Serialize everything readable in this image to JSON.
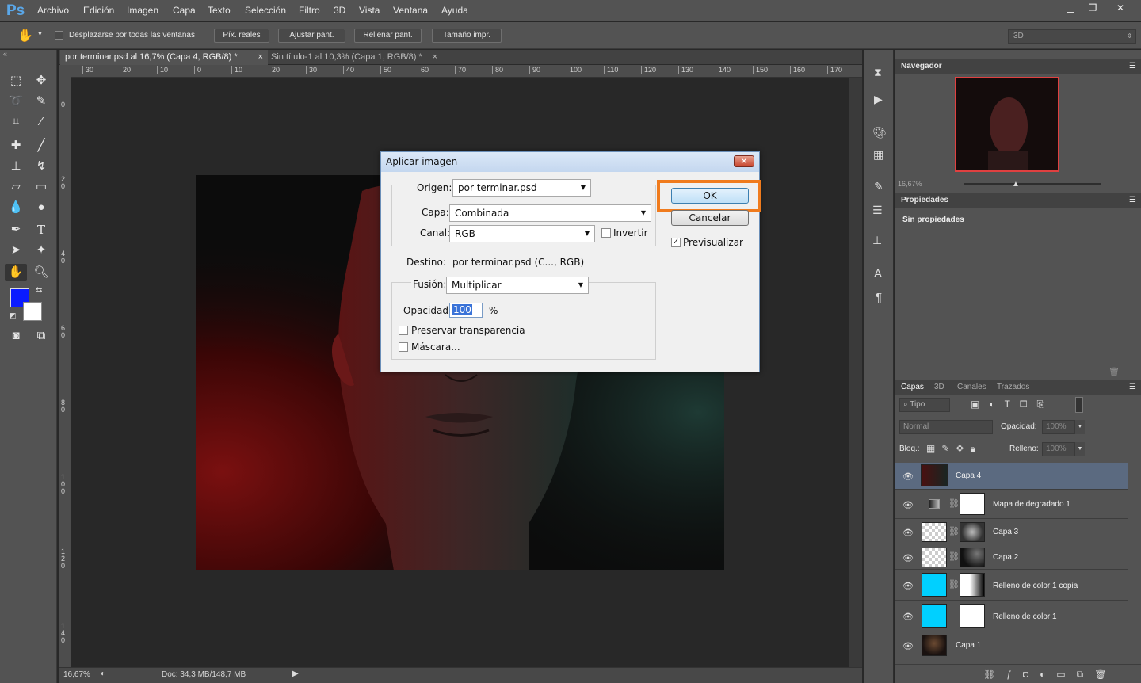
{
  "app": {
    "logo": "Ps"
  },
  "menu": [
    "Archivo",
    "Edición",
    "Imagen",
    "Capa",
    "Texto",
    "Selección",
    "Filtro",
    "3D",
    "Vista",
    "Ventana",
    "Ayuda"
  ],
  "options_bar": {
    "scroll_all_label": "Desplazarse por todas las ventanas",
    "buttons": [
      "Píx. reales",
      "Ajustar pant.",
      "Rellenar pant.",
      "Tamaño impr."
    ],
    "workspace": "3D"
  },
  "tabs": [
    {
      "label": "por terminar.psd al 16,7% (Capa 4, RGB/8) *"
    },
    {
      "label": "Sin título-1 al 10,3% (Capa 1, RGB/8) *"
    }
  ],
  "ruler_top": [
    "30",
    "20",
    "10",
    "0",
    "10",
    "20",
    "30",
    "40",
    "50",
    "60",
    "70",
    "80",
    "90",
    "100",
    "110",
    "120",
    "130",
    "140",
    "150",
    "160",
    "170"
  ],
  "ruler_left": [
    "0",
    "2 0",
    "4 0",
    "6 0",
    "8 0",
    "1 0 0",
    "1 2 0",
    "1 4 0"
  ],
  "status": {
    "zoom": "16,67%",
    "doc": "Doc: 34,3 MB/148,7 MB"
  },
  "colors": {
    "foreground": "#0a1bff",
    "background": "#ffffff",
    "accent_highlight": "#f07b1d"
  },
  "navigator": {
    "title": "Navegador",
    "zoom": "16,67%"
  },
  "properties": {
    "title": "Propiedades",
    "content": "Sin propiedades"
  },
  "layers_panel": {
    "tabs": [
      "Capas",
      "3D",
      "Canales",
      "Trazados"
    ],
    "filter": "Tipo",
    "blend_mode": "Normal",
    "opacity_label": "Opacidad:",
    "opacity_value": "100%",
    "lock_label": "Bloq.:",
    "fill_label": "Relleno:",
    "fill_value": "100%",
    "layers": [
      {
        "name": "Capa 4",
        "selected": true
      },
      {
        "name": "Mapa de degradado 1"
      },
      {
        "name": "Capa 3"
      },
      {
        "name": "Capa 2"
      },
      {
        "name": "Relleno de color 1 copia"
      },
      {
        "name": "Relleno de color 1"
      },
      {
        "name": "Capa 1"
      }
    ]
  },
  "dialog": {
    "title": "Aplicar imagen",
    "origen_label": "Origen:",
    "origen_value": "por terminar.psd",
    "capa_label": "Capa:",
    "capa_value": "Combinada",
    "canal_label": "Canal:",
    "canal_value": "RGB",
    "invertir_label": "Invertir",
    "destino_label": "Destino:",
    "destino_value": "por terminar.psd (C..., RGB)",
    "fusion_label": "Fusión:",
    "fusion_value": "Multiplicar",
    "opacidad_label": "Opacidad:",
    "opacidad_value": "100",
    "percent": "%",
    "preservar_label": "Preservar transparencia",
    "mascara_label": "Máscara...",
    "ok_label": "OK",
    "cancel_label": "Cancelar",
    "preview_label": "Previsualizar",
    "preview_checked": true
  }
}
